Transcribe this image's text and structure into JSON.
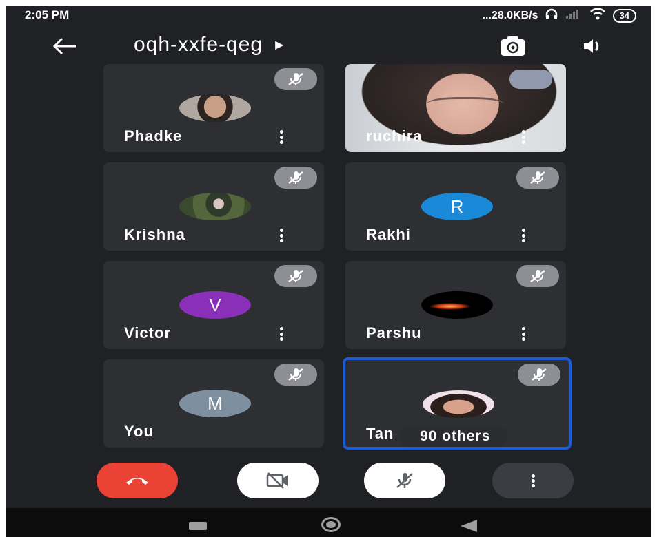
{
  "status_bar": {
    "time": "2:05 PM",
    "network_speed": "...28.0KB/s",
    "battery": "34"
  },
  "header": {
    "meeting_code": "oqh-xxfe-qeg"
  },
  "participants": [
    {
      "name": "Phadke",
      "avatar_type": "photo",
      "muted": true
    },
    {
      "name": "ruchira",
      "avatar_type": "video",
      "muted": false
    },
    {
      "name": "Krishna",
      "avatar_type": "photo",
      "muted": true
    },
    {
      "name": "Rakhi",
      "avatar_type": "initial",
      "initial": "R",
      "color": "#1a8ad8",
      "muted": true
    },
    {
      "name": "Victor",
      "avatar_type": "initial",
      "initial": "V",
      "color": "#8a2fb7",
      "muted": true
    },
    {
      "name": "Parshu",
      "avatar_type": "photo",
      "muted": true
    },
    {
      "name": "You",
      "avatar_type": "initial",
      "initial": "M",
      "color": "#7e8fa0",
      "muted": true
    },
    {
      "name": "Tan",
      "avatar_type": "photo",
      "muted": true,
      "active_speaker": true,
      "others_label": "90 others"
    }
  ],
  "controls": {
    "end_call": "end-call-icon",
    "camera": "camera-off-icon",
    "microphone": "mic-off-icon",
    "more": "more-vert-icon"
  },
  "colors": {
    "background": "#202124",
    "tile": "#2e2f33",
    "end_call": "#ea4335",
    "active_border": "#1a5bd8"
  }
}
